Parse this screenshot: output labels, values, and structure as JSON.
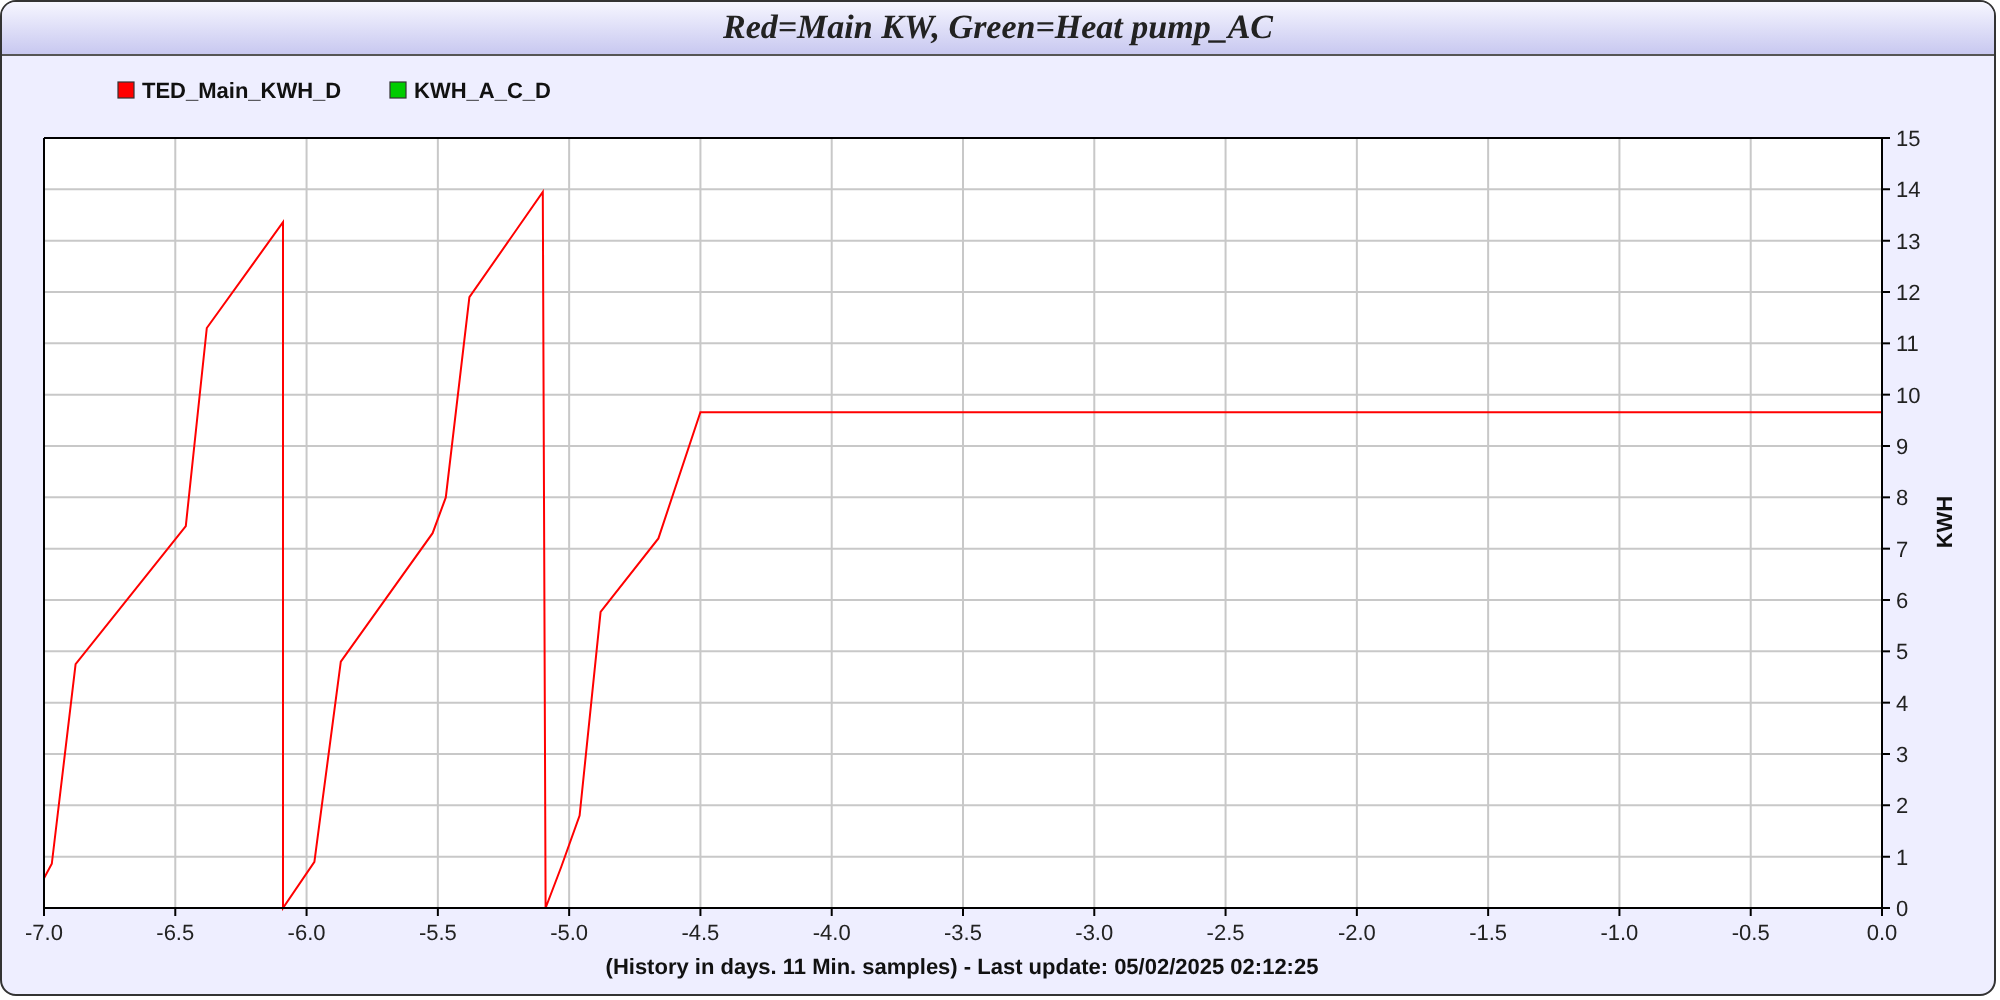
{
  "chart_data": {
    "type": "line",
    "title": "Red=Main KW, Green=Heat pump_AC",
    "xlabel": "(History in days. 11 Min. samples) - Last update: 05/02/2025 02:12:25",
    "ylabel": "KWH",
    "x": [
      -7,
      -6.97,
      -6.88,
      -6.46,
      -6.38,
      -6.09,
      -6.09,
      -5.97,
      -5.87,
      -5.52,
      -5.47,
      -5.38,
      -5.1,
      -5.09,
      -5.03,
      -4.96,
      -4.88,
      -4.66,
      -4.5,
      0
    ],
    "series": [
      {
        "name": "TED_Main_KWH_D",
        "color": "#ff0000",
        "values": [
          0.58,
          0.86,
          4.75,
          7.44,
          11.3,
          13.36,
          0,
          0.9,
          4.8,
          7.3,
          8,
          11.9,
          13.95,
          0,
          0.8,
          1.8,
          5.77,
          7.2,
          9.66,
          9.66
        ]
      },
      {
        "name": "KWH_A_C_D",
        "color": "#00cc00",
        "values": [
          null,
          null,
          null,
          null,
          null,
          null,
          null,
          null,
          null,
          null,
          null,
          null,
          null,
          null,
          null,
          null,
          null,
          null,
          null,
          null
        ]
      }
    ],
    "grid": true,
    "xlim": [
      -7,
      0
    ],
    "ylim": [
      0,
      15
    ],
    "xticks": [
      {
        "value": -7,
        "label": "-7.0"
      },
      {
        "value": -6.5,
        "label": "-6.5"
      },
      {
        "value": -6,
        "label": "-6.0"
      },
      {
        "value": -5.5,
        "label": "-5.5"
      },
      {
        "value": -5,
        "label": "-5.0"
      },
      {
        "value": -4.5,
        "label": "-4.5"
      },
      {
        "value": -4,
        "label": "-4.0"
      },
      {
        "value": -3.5,
        "label": "-3.5"
      },
      {
        "value": -3,
        "label": "-3.0"
      },
      {
        "value": -2.5,
        "label": "-2.5"
      },
      {
        "value": -2,
        "label": "-2.0"
      },
      {
        "value": -1.5,
        "label": "-1.5"
      },
      {
        "value": -1,
        "label": "-1.0"
      },
      {
        "value": -0.5,
        "label": "-0.5"
      },
      {
        "value": 0,
        "label": "0.0"
      }
    ],
    "yticks": [
      0,
      1,
      2,
      3,
      4,
      5,
      6,
      7,
      8,
      9,
      10,
      11,
      12,
      13,
      14,
      15
    ]
  }
}
